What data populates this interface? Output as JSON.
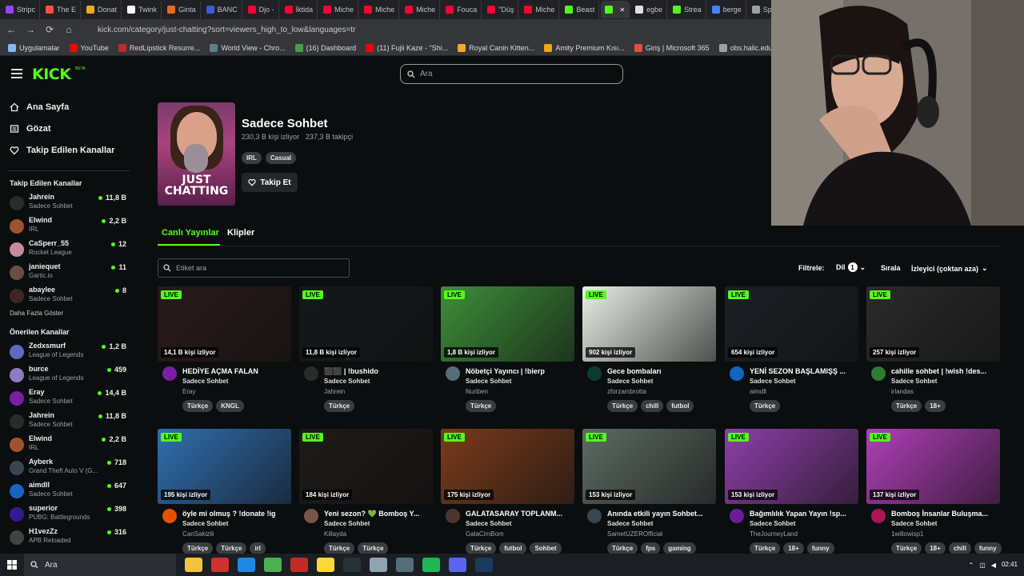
{
  "browser": {
    "tabs": [
      {
        "label": "Stripc",
        "color": "#9146ff"
      },
      {
        "label": "The E",
        "color": "#ff4e45"
      },
      {
        "label": "Donat",
        "color": "#f3a712"
      },
      {
        "label": "Twink",
        "color": "#ffffff"
      },
      {
        "label": "Ginta",
        "color": "#e86a1f"
      },
      {
        "label": "BANC",
        "color": "#3b5bdb"
      },
      {
        "label": "Djo -",
        "color": "#ff0033"
      },
      {
        "label": "İktida",
        "color": "#ff0033"
      },
      {
        "label": "Miche",
        "color": "#ff0033"
      },
      {
        "label": "Miche",
        "color": "#ff0033"
      },
      {
        "label": "Miche",
        "color": "#ff0033"
      },
      {
        "label": "Fouca",
        "color": "#ff0033"
      },
      {
        "label": "\"Düş",
        "color": "#ff0033"
      },
      {
        "label": "Miche",
        "color": "#ff0033"
      },
      {
        "label": "Beast",
        "color": "#53fc18"
      },
      {
        "label": "",
        "color": "#53fc18",
        "active": true
      },
      {
        "label": "egbe",
        "color": "#e0e0e0"
      },
      {
        "label": "Strea",
        "color": "#53fc18"
      },
      {
        "label": "berge",
        "color": "#4285f4"
      },
      {
        "label": "Spee",
        "color": "#9aa0a6"
      }
    ],
    "url": "kick.com/category/just-chatting?sort=viewers_high_to_low&languages=tr",
    "bookmarks": [
      {
        "label": "Uygulamalar",
        "color": "#8ab4f8"
      },
      {
        "label": "YouTube",
        "color": "#ff0000"
      },
      {
        "label": "RedLipstick Resurre...",
        "color": "#c62828"
      },
      {
        "label": "World View - Chro...",
        "color": "#607d8b"
      },
      {
        "label": "(16) Dashboard",
        "color": "#43a047"
      },
      {
        "label": "(11) Fujii Kaze - \"Shi...",
        "color": "#ff0000"
      },
      {
        "label": "Royal Canin Kitten...",
        "color": "#f9a825"
      },
      {
        "label": "Amity Premium Kısı...",
        "color": "#f3a712"
      },
      {
        "label": "Giriş | Microsoft 365",
        "color": "#e74c3c"
      },
      {
        "label": "obs.halic.edu.tr/oib...",
        "color": "#9aa0a6"
      }
    ]
  },
  "header": {
    "logo": "KICK",
    "logo_beta": "BETA",
    "search_placeholder": "Ara"
  },
  "sidebar": {
    "nav": [
      {
        "label": "Ana Sayfa",
        "icon": "home-icon"
      },
      {
        "label": "Gözat",
        "icon": "browse-icon"
      },
      {
        "label": "Takip Edilen Kanallar",
        "icon": "heart-icon"
      }
    ],
    "followed_title": "Takip Edilen Kanallar",
    "followed": [
      {
        "name": "Jahrein",
        "category": "Sadece Sohbet",
        "viewers": "11,8 B",
        "color": "#2b2b2b"
      },
      {
        "name": "Elwind",
        "category": "IRL",
        "viewers": "2,2 B",
        "color": "#a0522d"
      },
      {
        "name": "CaSperr_55",
        "category": "Rocket League",
        "viewers": "12",
        "color": "#c48b9f"
      },
      {
        "name": "janiequet",
        "category": "Gartic.io",
        "viewers": "11",
        "color": "#6d4c41"
      },
      {
        "name": "abaylee",
        "category": "Sadece Sohbet",
        "viewers": "8",
        "color": "#3e2723"
      }
    ],
    "show_more": "Daha Fazla Göster",
    "recommended_title": "Önerilen Kanallar",
    "recommended": [
      {
        "name": "Zedxsmurf",
        "category": "League of Legends",
        "viewers": "1,2 B",
        "color": "#5c6bc0"
      },
      {
        "name": "burce",
        "category": "League of Legends",
        "viewers": "459",
        "color": "#8e7cc3"
      },
      {
        "name": "Eray",
        "category": "Sadece Sohbet",
        "viewers": "14,4 B",
        "color": "#7b1fa2"
      },
      {
        "name": "Jahrein",
        "category": "Sadece Sohbet",
        "viewers": "11,8 B",
        "color": "#2b2b2b"
      },
      {
        "name": "Elwind",
        "category": "IRL",
        "viewers": "2,2 B",
        "color": "#a0522d"
      },
      {
        "name": "Ayberk",
        "category": "Grand Theft Auto V (G...",
        "viewers": "718",
        "color": "#37474f"
      },
      {
        "name": "aimdll",
        "category": "Sadece Sohbet",
        "viewers": "647",
        "color": "#1565c0"
      },
      {
        "name": "superior",
        "category": "PUBG: Battlegrounds",
        "viewers": "398",
        "color": "#311b92"
      },
      {
        "name": "H1vezZz",
        "category": "APB Reloaded",
        "viewers": "316",
        "color": "#424242"
      }
    ]
  },
  "category": {
    "thumb_text_1": "JUST",
    "thumb_text_2": "CHATTING",
    "title": "Sadece Sohbet",
    "watching": "230,3 B kişi izliyor",
    "followers": "237,3 B takipçi",
    "tags": [
      "IRL",
      "Casual"
    ],
    "follow_label": "Takip Et"
  },
  "tabs": {
    "live": "Canlı Yayınlar",
    "clips": "Klipler"
  },
  "filters": {
    "tag_search_placeholder": "Etiket ara",
    "filter_label": "Filtrele:",
    "language_label": "Dil",
    "language_count": "1",
    "sort_label": "Sırala",
    "sort_value": "İzleyici (çoktan aza)"
  },
  "streams": [
    {
      "title": "HEDİYE AÇMA FALAN",
      "category": "Sadece Sohbet",
      "user": "Eray",
      "viewers": "14,1 B kişi izliyor",
      "tags": [
        "Türkçe",
        "KNGL"
      ],
      "live": "LIVE",
      "thumb": "#2a1a1a",
      "avatar": "#7b1fa2"
    },
    {
      "title": "⬛⬛ | !bushido",
      "category": "Sadece Sohbet",
      "user": "Jahrein",
      "viewers": "11,8 B kişi izliyor",
      "tags": [
        "Türkçe"
      ],
      "live": "LIVE",
      "thumb": "#15181b",
      "avatar": "#2b2b2b"
    },
    {
      "title": "Nöbetçi Yayıncı | !bierp",
      "category": "Sadece Sohbet",
      "user": "Nuriben",
      "viewers": "1,8 B kişi izliyor",
      "tags": [
        "Türkçe"
      ],
      "live": "LIVE",
      "thumb": "#3e8e3a",
      "avatar": "#546e7a"
    },
    {
      "title": "Gece bombaları",
      "category": "Sadece Sohbet",
      "user": "zforzambrotta",
      "viewers": "902 kişi izliyor",
      "tags": [
        "Türkçe",
        "chill",
        "futbol"
      ],
      "live": "LIVE",
      "thumb": "#e8efe6",
      "avatar": "#0d3b2e"
    },
    {
      "title": "YENİ SEZON BAŞLAMIŞŞ ...",
      "category": "Sadece Sohbet",
      "user": "aimdll",
      "viewers": "654 kişi izliyor",
      "tags": [
        "Türkçe"
      ],
      "live": "LIVE",
      "thumb": "#1b1f24",
      "avatar": "#1565c0"
    },
    {
      "title": "cahille sohbet | !wish !des...",
      "category": "Sadece Sohbet",
      "user": "irlandas",
      "viewers": "257 kişi izliyor",
      "tags": [
        "Türkçe",
        "18+"
      ],
      "live": "LIVE",
      "thumb": "#2c2a2a",
      "avatar": "#2e7d32"
    },
    {
      "title": "öyle mi olmuş ? !donate !ig",
      "category": "Sadece Sohbet",
      "user": "CanSakizlii",
      "viewers": "195 kişi izliyor",
      "tags": [
        "Türkçe",
        "Türkçe",
        "irl"
      ],
      "live": "LIVE",
      "thumb": "#2f6fb0",
      "avatar": "#e65100"
    },
    {
      "title": "Yeni sezon? 💚 Bomboş Y...",
      "category": "Sadece Sohbet",
      "user": "Killayda",
      "viewers": "184 kişi izliyor",
      "tags": [
        "Türkçe",
        "Türkçe"
      ],
      "live": "LIVE",
      "thumb": "#1e1a17",
      "avatar": "#795548"
    },
    {
      "title": "GALATASARAY TOPLANM...",
      "category": "Sadece Sohbet",
      "user": "GalaCimBom",
      "viewers": "175 kişi izliyor",
      "tags": [
        "Türkçe",
        "futbol",
        "Sohbet"
      ],
      "live": "LIVE",
      "thumb": "#7a3b1c",
      "avatar": "#4e342e"
    },
    {
      "title": "Anında etkili yayın Sohbet...",
      "category": "Sadece Sohbet",
      "user": "SametUZEROfficial",
      "viewers": "153 kişi izliyor",
      "tags": [
        "Türkçe",
        "fps",
        "gaming"
      ],
      "live": "LIVE",
      "thumb": "#5d6b63",
      "avatar": "#37474f"
    },
    {
      "title": "Bağımlılık Yapan Yayın !sp...",
      "category": "Sadece Sohbet",
      "user": "TheJourneyLand",
      "viewers": "153 kişi izliyor",
      "tags": [
        "Türkçe",
        "18+",
        "funny"
      ],
      "live": "LIVE",
      "thumb": "#8e3fa8",
      "avatar": "#6a1b9a"
    },
    {
      "title": "Bomboş İnsanlar Buluşma...",
      "category": "Sadece Sohbet",
      "user": "1willowisp1",
      "viewers": "137 kişi izliyor",
      "tags": [
        "Türkçe",
        "18+",
        "chill",
        "funny"
      ],
      "live": "LIVE",
      "thumb": "#b03fb8",
      "avatar": "#ad1457"
    }
  ],
  "taskbar": {
    "search_placeholder": "Ara",
    "clock_time": "02:41",
    "apps": [
      {
        "name": "file-explorer-icon",
        "color": "#f3c33a"
      },
      {
        "name": "opera-icon",
        "color": "#d32f2f"
      },
      {
        "name": "edge-icon",
        "color": "#1e88e5"
      },
      {
        "name": "chrome-icon",
        "color": "#4caf50"
      },
      {
        "name": "app-icon",
        "color": "#c62828"
      },
      {
        "name": "notes-icon",
        "color": "#fdd835"
      },
      {
        "name": "obs-icon",
        "color": "#263238"
      },
      {
        "name": "settings-icon",
        "color": "#90a4ae"
      },
      {
        "name": "steam-icon",
        "color": "#546e7a"
      },
      {
        "name": "spotify-icon",
        "color": "#1db954"
      },
      {
        "name": "discord-icon",
        "color": "#5865f2"
      },
      {
        "name": "steam-app-icon",
        "color": "#1a3b5d"
      }
    ]
  }
}
